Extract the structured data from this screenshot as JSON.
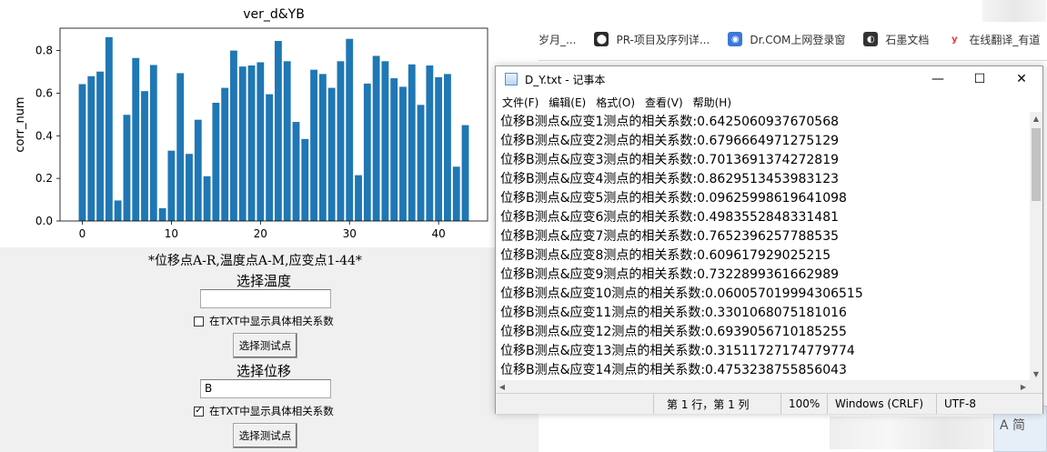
{
  "figure": {
    "chart_data": {
      "type": "bar",
      "title": "ver_d&YB",
      "xlabel": "",
      "ylabel": "corr_num",
      "xlim": [
        -2.5,
        45.5
      ],
      "ylim": [
        0,
        0.905
      ],
      "x_ticks": [
        0,
        10,
        20,
        30,
        40
      ],
      "y_ticks": [
        0.0,
        0.2,
        0.4,
        0.6,
        0.8
      ],
      "x_tick_labels": [
        "0",
        "10",
        "20",
        "30",
        "40"
      ],
      "y_tick_labels": [
        "0.0",
        "0.2",
        "0.4",
        "0.6",
        "0.8"
      ],
      "grid": false,
      "bar_color": "#1f77b4",
      "x": [
        0,
        1,
        2,
        3,
        4,
        5,
        6,
        7,
        8,
        9,
        10,
        11,
        12,
        13,
        14,
        15,
        16,
        17,
        18,
        19,
        20,
        21,
        22,
        23,
        24,
        25,
        26,
        27,
        28,
        29,
        30,
        31,
        32,
        33,
        34,
        35,
        36,
        37,
        38,
        39,
        40,
        41,
        42,
        43
      ],
      "values": [
        0.6425,
        0.6797,
        0.7014,
        0.863,
        0.0963,
        0.4984,
        0.7652,
        0.6096,
        0.7323,
        0.0601,
        0.3301,
        0.6939,
        0.3151,
        0.4753,
        0.21,
        0.555,
        0.625,
        0.8,
        0.725,
        0.73,
        0.745,
        0.595,
        0.845,
        0.75,
        0.465,
        0.385,
        0.71,
        0.69,
        0.625,
        0.75,
        0.855,
        0.215,
        0.645,
        0.775,
        0.75,
        0.67,
        0.63,
        0.735,
        0.545,
        0.73,
        0.675,
        0.69,
        0.255,
        0.45
      ]
    }
  },
  "controls": {
    "legend_text": "*位移点A-R,温度点A-M,应变点1-44*",
    "temp_label": "选择温度",
    "temp_value": "",
    "temp_checkbox_label": "在TXT中显示具体相关系数",
    "temp_checked": false,
    "temp_button": "选择测试点",
    "disp_label": "选择位移",
    "disp_value": "B",
    "disp_checkbox_label": "在TXT中显示具体相关系数",
    "disp_checked": true,
    "disp_button": "选择测试点",
    "check_mark": "✓"
  },
  "browser": {
    "bookmarks": [
      {
        "label": "岁月_...",
        "icon": "bookmark-icon",
        "color": "#999999"
      },
      {
        "label": "PR-项目及序列详...",
        "icon": "pr-app-icon",
        "color": "#2b2b2b"
      },
      {
        "label": "Dr.COM上网登录窗",
        "icon": "drcom-globe-icon",
        "color": "#3b78d8"
      },
      {
        "label": "石墨文档",
        "icon": "shimo-docs-icon",
        "color": "#333333"
      },
      {
        "label": "在线翻译_有道",
        "icon": "youdao-icon",
        "color": "#e53935"
      }
    ],
    "ime_text": "A 简"
  },
  "notepad": {
    "title": "D_Y.txt - 记事本",
    "menu": [
      "文件(F)",
      "编辑(E)",
      "格式(O)",
      "查看(V)",
      "帮助(H)"
    ],
    "lines": [
      "位移B测点&应变1测点的相关系数:0.6425060937670568",
      "位移B测点&应变2测点的相关系数:0.6796664971275129",
      "位移B测点&应变3测点的相关系数:0.7013691374272819",
      "位移B测点&应变4测点的相关系数:0.8629513453983123",
      "位移B测点&应变5测点的相关系数:0.09625998619641098",
      "位移B测点&应变6测点的相关系数:0.4983552848331481",
      "位移B测点&应变7测点的相关系数:0.7652396257788535",
      "位移B测点&应变8测点的相关系数:0.609617929025215",
      "位移B测点&应变9测点的相关系数:0.7322899361662989",
      "位移B测点&应变10测点的相关系数:0.060057019994306515",
      "位移B测点&应变11测点的相关系数:0.3301068075181016",
      "位移B测点&应变12测点的相关系数:0.6939056710185255",
      "位移B测点&应变13测点的相关系数:0.31511727174779774",
      "位移B测点&应变14测点的相关系数:0.4753238755856043"
    ],
    "status": {
      "position": "第 1 行，第 1 列",
      "zoom": "100%",
      "line_ending": "Windows (CRLF)",
      "encoding": "UTF-8"
    }
  }
}
